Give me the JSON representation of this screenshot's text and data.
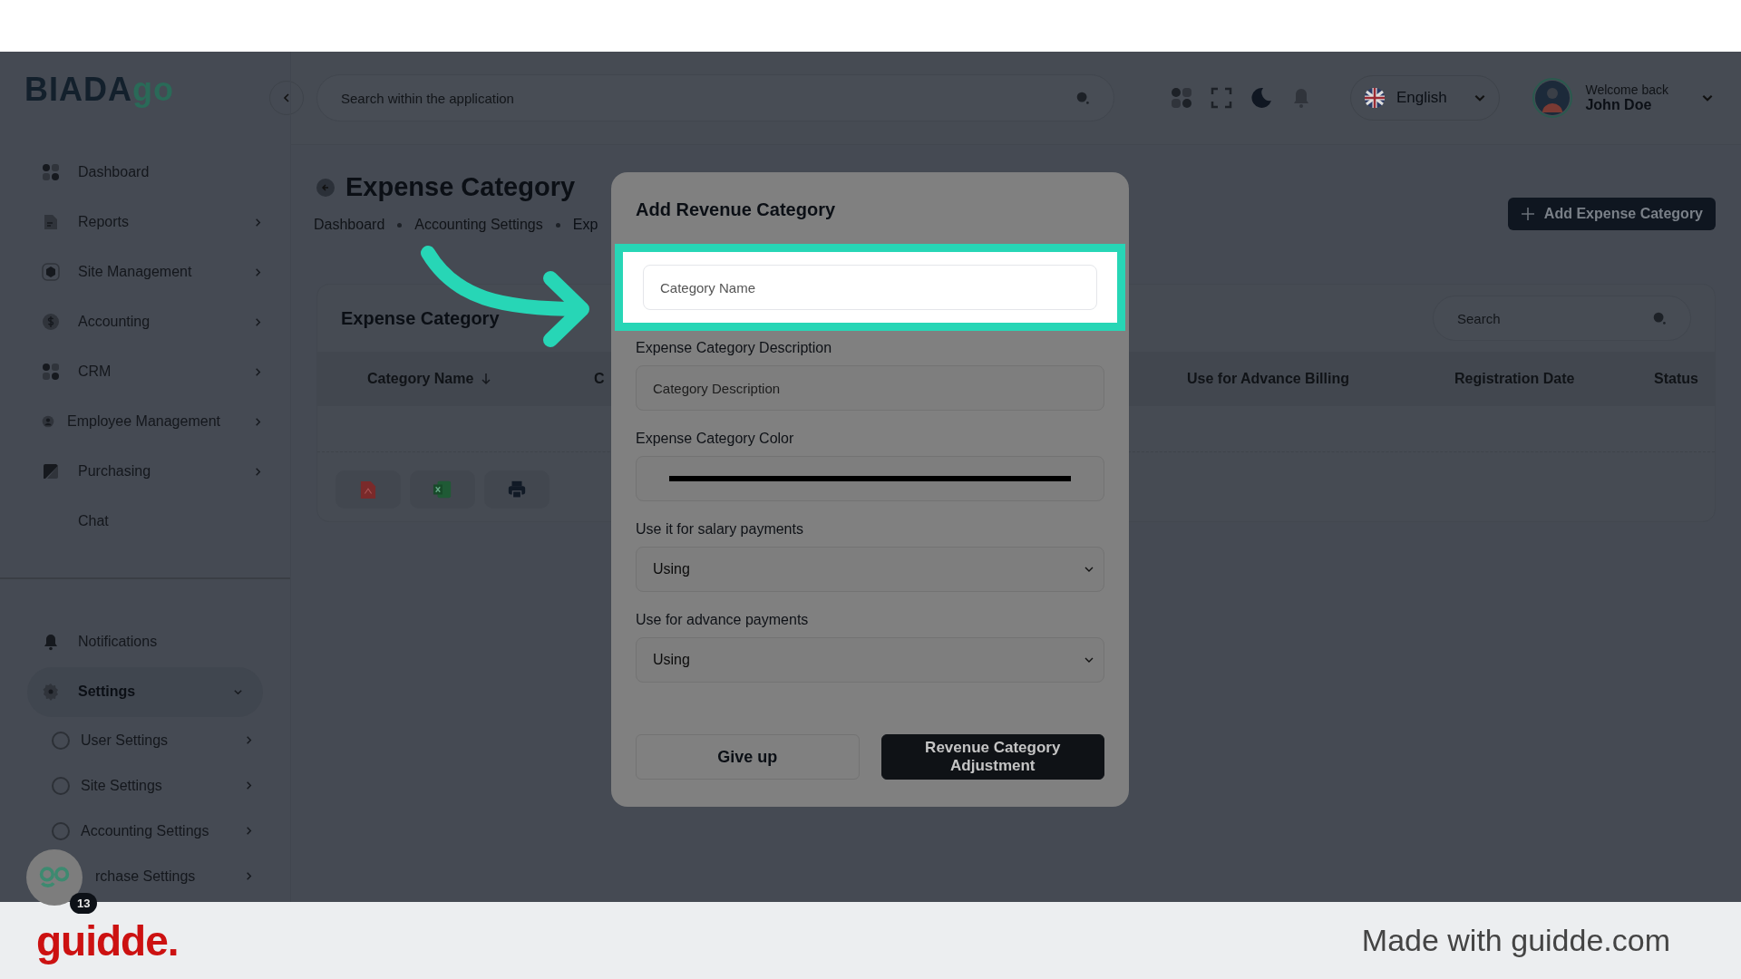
{
  "logo": {
    "text": "BIADA",
    "accent": "go"
  },
  "header": {
    "search": {
      "placeholder": "Search within the application"
    },
    "language": "English",
    "user": {
      "greeting": "Welcome back",
      "name": "John Doe"
    }
  },
  "sidebar": {
    "items": [
      {
        "label": "Dashboard",
        "kind": "link",
        "selected": false
      },
      {
        "label": "Reports",
        "kind": "menu",
        "expanded": false,
        "selected": false
      },
      {
        "label": "Site Management",
        "kind": "menu",
        "expanded": false,
        "selected": false
      },
      {
        "label": "Accounting",
        "kind": "menu",
        "expanded": false,
        "selected": false
      },
      {
        "label": "CRM",
        "kind": "menu",
        "expanded": false,
        "selected": false
      },
      {
        "label": "Employee Management",
        "kind": "menu",
        "expanded": false,
        "selected": false
      },
      {
        "label": "Purchasing",
        "kind": "menu",
        "expanded": false,
        "selected": false
      },
      {
        "label": "Chat",
        "kind": "link",
        "selected": false
      }
    ],
    "bottom_items": [
      {
        "label": "Notifications",
        "kind": "link",
        "selected": false
      },
      {
        "label": "Settings",
        "kind": "menu",
        "expanded": true,
        "selected": true,
        "children": [
          {
            "label": "User Settings"
          },
          {
            "label": "Site Settings"
          },
          {
            "label": "Accounting Settings"
          },
          {
            "label": "rchase Settings"
          }
        ]
      }
    ]
  },
  "help_widget": {
    "badge": "13"
  },
  "page": {
    "title": "Expense Category",
    "breadcrumbs": [
      "Dashboard",
      "Accounting Settings",
      "Exp"
    ],
    "add_button": "Add Expense Category",
    "card": {
      "title": "Expense Category",
      "search": {
        "placeholder": "Search"
      },
      "columns": [
        {
          "label": "Category Name",
          "sorted": true
        },
        {
          "label": "C",
          "sorted": false
        },
        {
          "label": "Use for Advance Billing",
          "sorted": false
        },
        {
          "label": "Registration Date",
          "sorted": false
        },
        {
          "label": "Status",
          "sorted": false
        }
      ]
    }
  },
  "modal": {
    "title": "Add Revenue Category",
    "fields": [
      {
        "kind": "text",
        "placeholder": "Category Name",
        "highlighted": true
      },
      {
        "kind": "text",
        "label": "Expense Category Description",
        "placeholder": "Category Description",
        "highlighted": false
      },
      {
        "kind": "color",
        "label": "Expense Category Color",
        "highlighted": false
      },
      {
        "kind": "select",
        "label": "Use it for salary payments",
        "value": "Using",
        "highlighted": false
      },
      {
        "kind": "select",
        "label": "Use for advance payments",
        "value": "Using",
        "highlighted": false
      }
    ],
    "buttons": [
      {
        "label": "Give up",
        "kind": "secondary"
      },
      {
        "label": "Revenue Category Adjustment",
        "kind": "primary"
      }
    ]
  },
  "footer": {
    "brand": "guidde.",
    "credit": "Made with guidde.com"
  }
}
